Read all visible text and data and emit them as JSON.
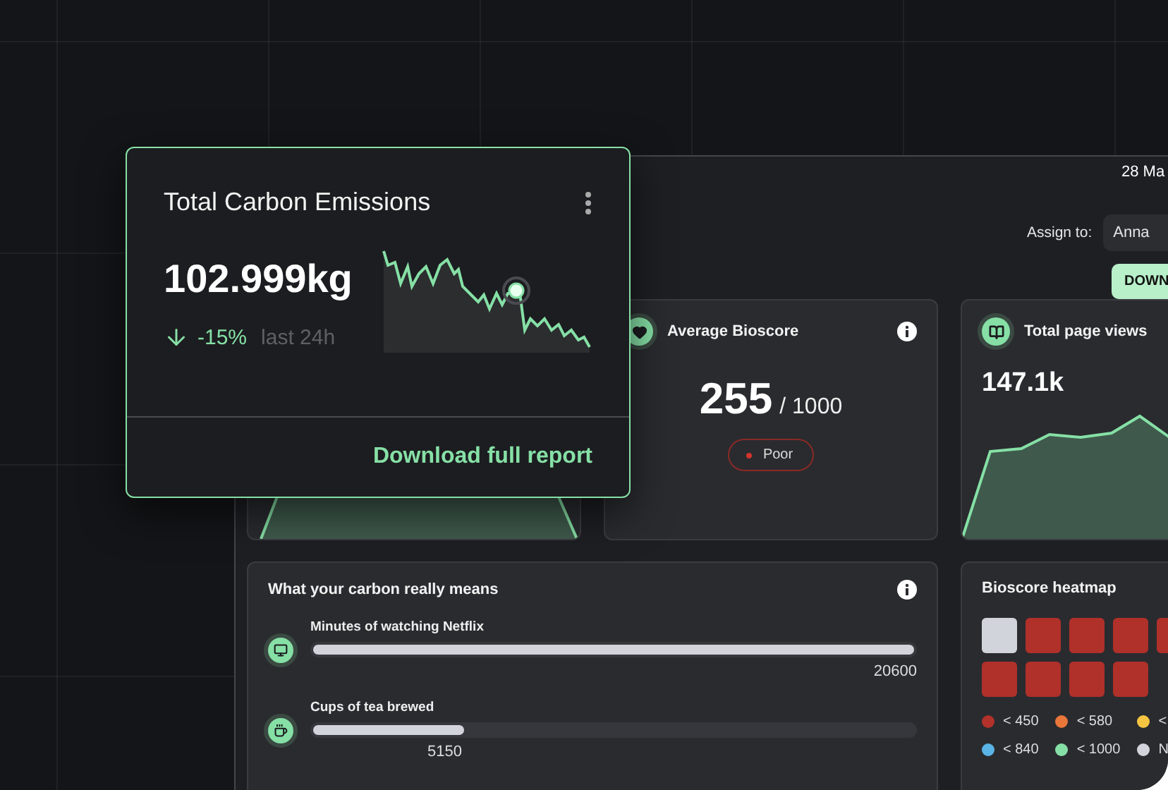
{
  "popup_card": {
    "title": "Total Carbon Emissions",
    "value": "102.999kg",
    "change": "-15%",
    "period": "last 24h",
    "link": "Download full report"
  },
  "header": {
    "date": "28 Ma",
    "assign_label": "Assign to:",
    "assignee": "Anna",
    "button": "DOWN"
  },
  "bioscore_card": {
    "title": "Average Bioscore",
    "score": "255",
    "max": "/ 1000",
    "rating": "Poor"
  },
  "page_views_card": {
    "title": "Total page views",
    "value": "147.1k"
  },
  "carbon_card": {
    "title": "What your carbon really means",
    "items": [
      {
        "kind": "screen",
        "label": "Minutes of watching Netflix",
        "value": "20600",
        "level": 1
      },
      {
        "kind": "cup",
        "label": "Cups of tea brewed",
        "value": "5150",
        "level": 0.25
      }
    ]
  },
  "heatmap_card": {
    "title": "Bioscore heatmap",
    "cells": [
      {
        "color": "#d1d5db"
      },
      {
        "color": "#b0302a"
      },
      {
        "color": "#b0302a"
      },
      {
        "color": "#b0302a"
      },
      {
        "color": "#b0302a"
      },
      {
        "color": "#b0302a"
      },
      {
        "color": "#b0302a"
      },
      {
        "color": "#b0302a"
      },
      {
        "color": "#b0302a"
      }
    ],
    "legend": [
      {
        "label": "< 450",
        "color": "#b3312b"
      },
      {
        "label": "< 580",
        "color": "#e9773a"
      },
      {
        "label": "<",
        "color": "#f5c542"
      },
      {
        "label": "< 840",
        "color": "#5ab4e5"
      },
      {
        "label": "< 1000",
        "color": "#86e0a6"
      },
      {
        "label": "N",
        "color": "#d1d5db"
      }
    ]
  }
}
